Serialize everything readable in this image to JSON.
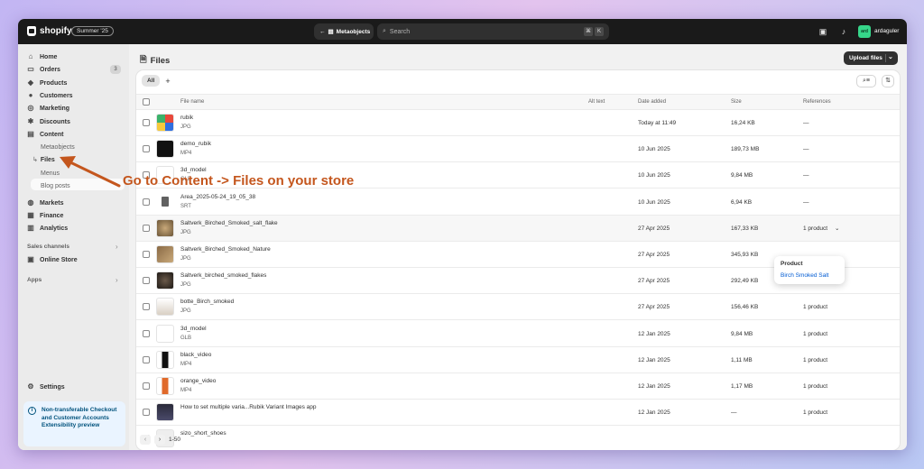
{
  "topbar": {
    "brand": "shopify",
    "edition": "Summer '25",
    "breadcrumb": "Metaobjects",
    "search_placeholder": "Search",
    "kbd1": "⌘",
    "kbd2": "K",
    "avatar_initials": "ard",
    "username": "ardaguler"
  },
  "sidebar": {
    "home": "Home",
    "orders": "Orders",
    "orders_count": "3",
    "products": "Products",
    "customers": "Customers",
    "marketing": "Marketing",
    "discounts": "Discounts",
    "content": "Content",
    "metaobjects": "Metaobjects",
    "files": "Files",
    "menus": "Menus",
    "blog_posts": "Blog posts",
    "markets": "Markets",
    "finance": "Finance",
    "analytics": "Analytics",
    "sales_channels": "Sales channels",
    "online_store": "Online Store",
    "apps": "Apps",
    "settings": "Settings",
    "notice": "Non-transferable Checkout and Customer Accounts Extensibility preview"
  },
  "page": {
    "title": "Files",
    "upload_label": "Upload files",
    "tab_all": "All",
    "tab_add": "+"
  },
  "table": {
    "headers": {
      "name": "File name",
      "alt": "Alt text",
      "date": "Date added",
      "size": "Size",
      "refs": "References"
    },
    "rows": [
      {
        "name": "rubik",
        "type": "JPG",
        "date": "Today at 11:49",
        "size": "16,24 KB",
        "refs": "—"
      },
      {
        "name": "demo_rubik",
        "type": "MP4",
        "date": "10 Jun 2025",
        "size": "189,73 MB",
        "refs": "—"
      },
      {
        "name": "3d_model",
        "type": "GLB",
        "date": "10 Jun 2025",
        "size": "9,84 MB",
        "refs": "—"
      },
      {
        "name": "Area_2025-05-24_19_05_38",
        "type": "SRT",
        "date": "10 Jun 2025",
        "size": "6,94 KB",
        "refs": "—"
      },
      {
        "name": "Saltverk_Birched_Smoked_salt_flake",
        "type": "JPG",
        "date": "27 Apr 2025",
        "size": "167,33 KB",
        "refs": "1 product"
      },
      {
        "name": "Saltverk_Birched_Smoked_Nature",
        "type": "JPG",
        "date": "27 Apr 2025",
        "size": "345,93 KB",
        "refs": ""
      },
      {
        "name": "Saltverk_birched_smoked_flakes",
        "type": "JPG",
        "date": "27 Apr 2025",
        "size": "292,49 KB",
        "refs": "1 product"
      },
      {
        "name": "botte_Birch_smoked",
        "type": "JPG",
        "date": "27 Apr 2025",
        "size": "156,46 KB",
        "refs": "1 product"
      },
      {
        "name": "3d_model",
        "type": "GLB",
        "date": "12 Jan 2025",
        "size": "9,84 MB",
        "refs": "1 product"
      },
      {
        "name": "black_video",
        "type": "MP4",
        "date": "12 Jan 2025",
        "size": "1,11 MB",
        "refs": "1 product"
      },
      {
        "name": "orange_video",
        "type": "MP4",
        "date": "12 Jan 2025",
        "size": "1,17 MB",
        "refs": "1 product"
      },
      {
        "name": "How to set multiple varia...Rubik Variant Images app",
        "type": "",
        "date": "12 Jan 2025",
        "size": "—",
        "refs": "1 product"
      },
      {
        "name": "sizo_short_shoes",
        "type": "",
        "date": "",
        "size": "",
        "refs": ""
      }
    ]
  },
  "popover": {
    "title": "Product",
    "link": "Birch Smoked Salt"
  },
  "pager": {
    "range": "1-50"
  },
  "annotation": "Go to Content -> Files on your store",
  "colors": {
    "accent": "#c4561d",
    "link": "#005bd3",
    "topbar": "#1a1a1a"
  }
}
